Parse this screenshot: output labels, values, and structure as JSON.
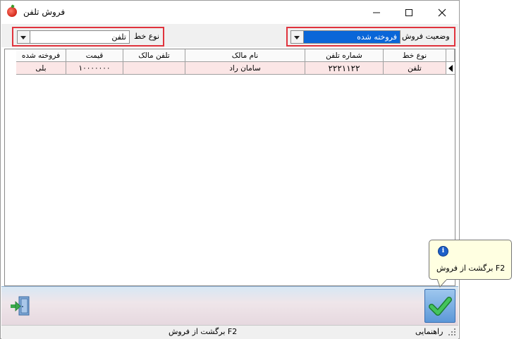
{
  "window": {
    "title": "فروش تلفن"
  },
  "filters": {
    "line_type_label": "نوع خط",
    "line_type_value": "تلفن",
    "sale_status_label": "وضعیت فروش",
    "sale_status_value": "فروخته شده"
  },
  "grid": {
    "columns": [
      "نوع خط",
      "شماره تلفن",
      "نام مالک",
      "تلفن مالک",
      "قیمت",
      "فروخته شده"
    ],
    "rows": [
      [
        "تلفن",
        "۲۲۲۱۱۲۲",
        "سامان راد",
        "",
        "۱۰۰۰۰۰۰۰",
        "بلی"
      ]
    ]
  },
  "tooltip": {
    "text": "F2 برگشت از فروش"
  },
  "statusbar": {
    "help_label": "راهنمایی",
    "hint": "F2 برگشت از فروش"
  },
  "colors": {
    "highlight": "#e0333d",
    "selection": "#0a66d8",
    "row_bg": "#fbe6e6",
    "ok_check": "#2fa84a"
  },
  "icons": {
    "app": "tomato-icon",
    "exit": "exit-door-icon",
    "ok": "checkmark-icon",
    "info": "info-icon"
  }
}
